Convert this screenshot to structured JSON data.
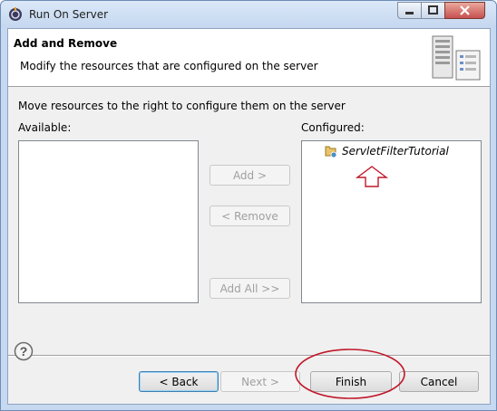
{
  "window": {
    "title": "Run On Server"
  },
  "banner": {
    "title": "Add and Remove",
    "description": "Modify the resources that are configured on the server"
  },
  "instruction": "Move resources to the right to configure them on the server",
  "available": {
    "label": "Available:",
    "items": []
  },
  "configured": {
    "label": "Configured:",
    "items": [
      {
        "label": "ServletFilterTutorial"
      }
    ]
  },
  "buttons": {
    "add": "Add >",
    "remove": "< Remove",
    "add_all": "Add All >>",
    "back": "< Back",
    "next": "Next >",
    "finish": "Finish",
    "cancel": "Cancel"
  },
  "colors": {
    "annotation": "#c0182a",
    "title_bar": "#c4d7ef"
  },
  "icons": [
    "app-icon",
    "server-icon",
    "project-icon",
    "help-icon",
    "minimize-icon",
    "maximize-icon",
    "close-icon"
  ]
}
